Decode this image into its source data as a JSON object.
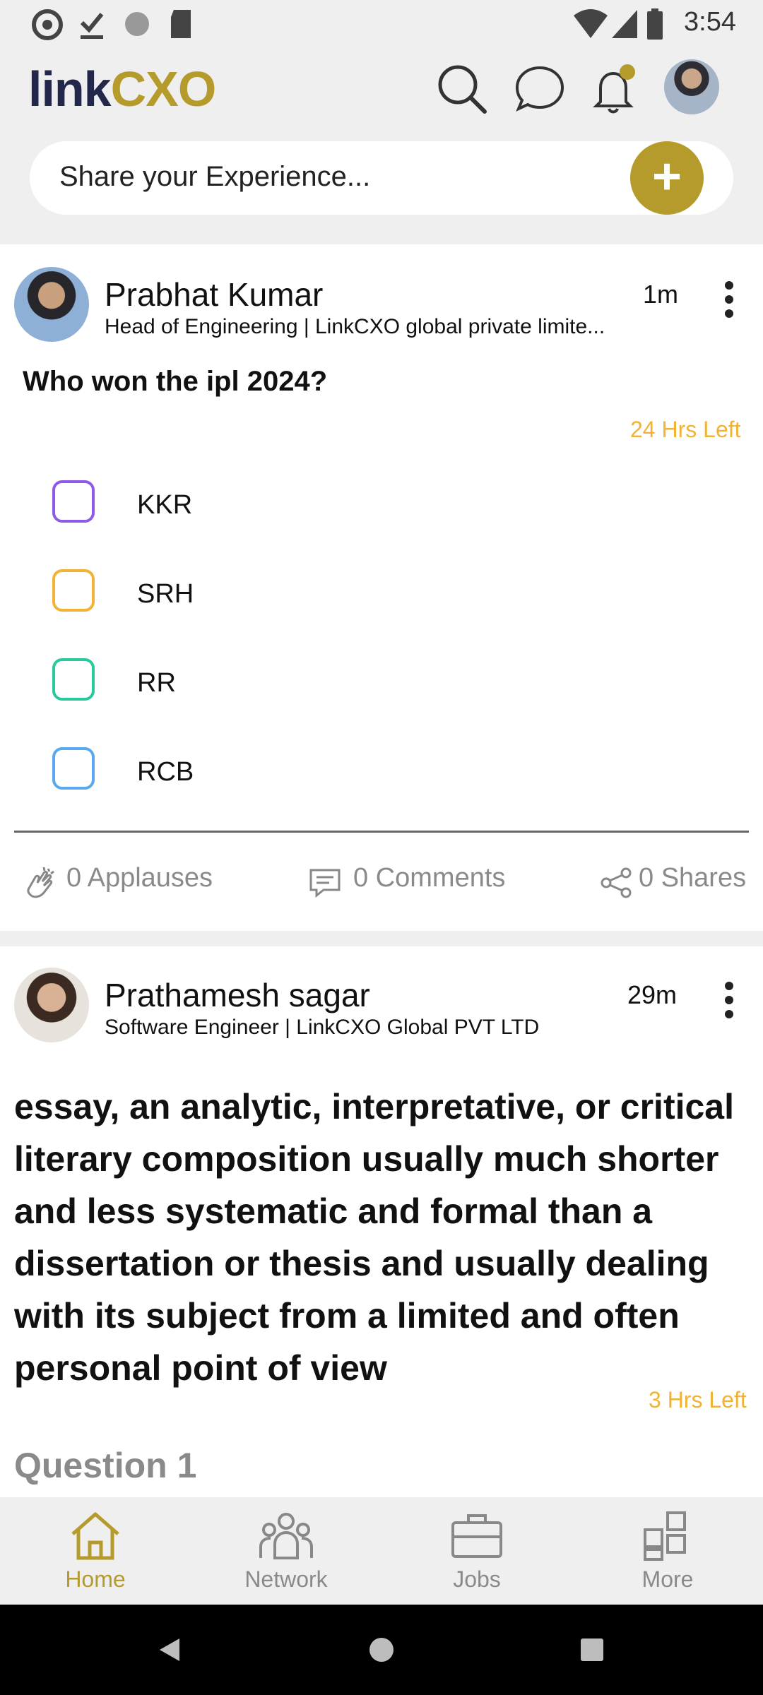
{
  "status_bar": {
    "time": "3:54"
  },
  "header": {
    "logo_part1": "link",
    "logo_part2": "CXO",
    "icons": [
      "search-icon",
      "chat-icon",
      "bell-icon"
    ],
    "composer_placeholder": "Share your Experience...",
    "colors": {
      "brand_gold": "#b49b2b",
      "brand_dark": "#23284a"
    }
  },
  "posts": [
    {
      "author": "Prabhat Kumar",
      "subtitle": "Head of Engineering | LinkCXO global private limite...",
      "time": "1m",
      "question": "Who won the ipl 2024?",
      "hours_left": "24 Hrs Left",
      "options": [
        {
          "label": "KKR",
          "color": "#8e5be8"
        },
        {
          "label": "SRH",
          "color": "#f2b233"
        },
        {
          "label": "RR",
          "color": "#28c99a"
        },
        {
          "label": "RCB",
          "color": "#5aa8ee"
        }
      ],
      "applauses": "0 Applauses",
      "comments": "0 Comments",
      "shares": "0 Shares"
    },
    {
      "author": "Prathamesh sagar",
      "subtitle": "Software  Engineer | LinkCXO Global PVT LTD",
      "time": "29m",
      "body": "essay, an analytic, interpretative, or critical literary composition usually much shorter and less systematic and formal than a dissertation or thesis and usually dealing with its subject from a limited and often personal point of view",
      "hours_left": "3 Hrs Left",
      "next_heading": "Question 1"
    }
  ],
  "bottom_nav": [
    {
      "label": "Home",
      "icon": "home-icon",
      "active": true
    },
    {
      "label": "Network",
      "icon": "network-icon",
      "active": false
    },
    {
      "label": "Jobs",
      "icon": "briefcase-icon",
      "active": false
    },
    {
      "label": "More",
      "icon": "grid-icon",
      "active": false
    }
  ]
}
